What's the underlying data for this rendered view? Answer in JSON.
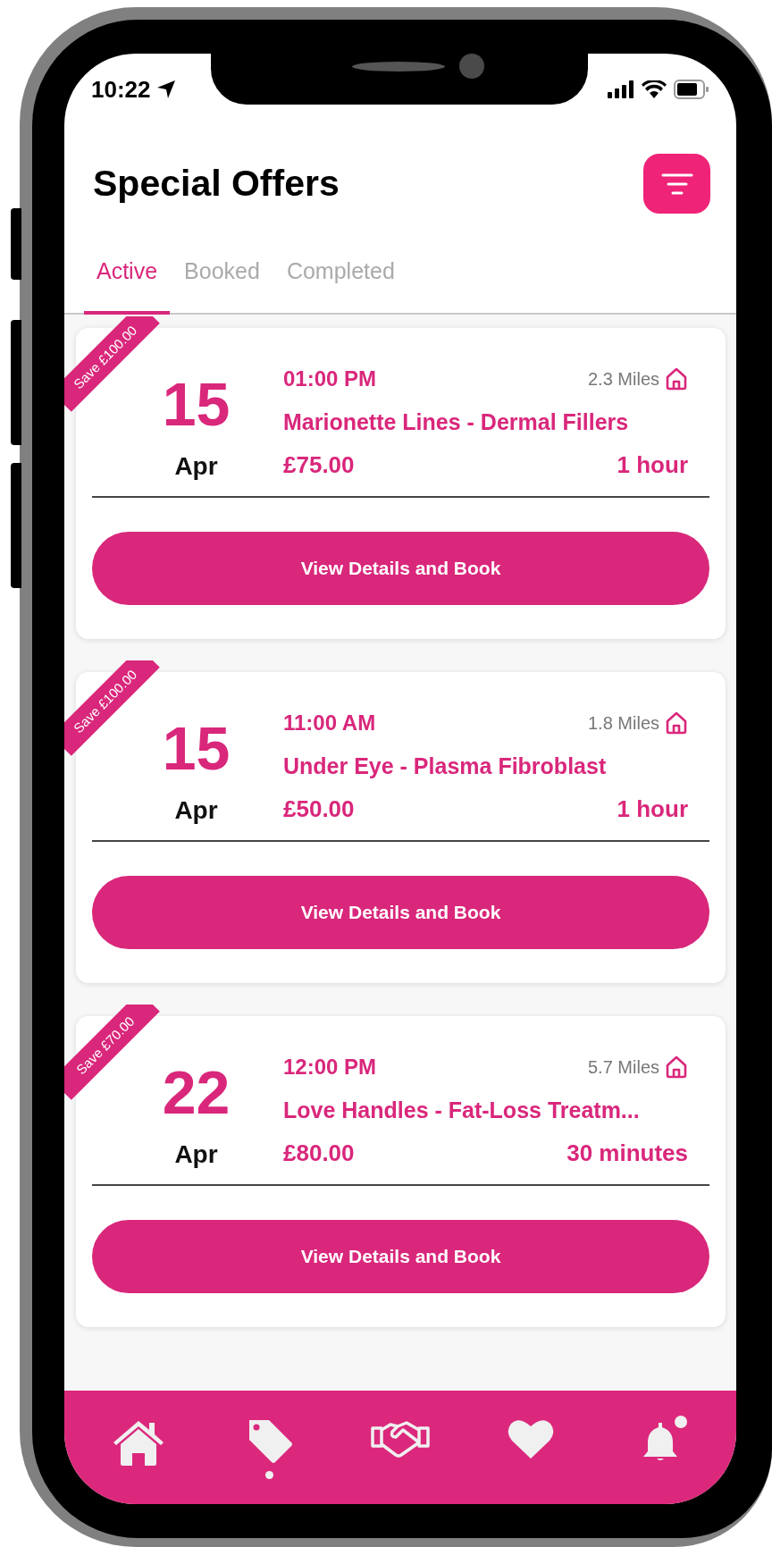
{
  "status_bar": {
    "time": "10:22"
  },
  "header": {
    "title": "Special Offers"
  },
  "tabs": [
    {
      "label": "Active",
      "selected": true
    },
    {
      "label": "Booked",
      "selected": false
    },
    {
      "label": "Completed",
      "selected": false
    }
  ],
  "offers": [
    {
      "ribbon": "Save £100.00",
      "day": "15",
      "month": "Apr",
      "time": "01:00 PM",
      "distance": "2.3 Miles",
      "title": "Marionette Lines - Dermal Fillers",
      "price": "£75.00",
      "duration": "1 hour",
      "button": "View Details and Book"
    },
    {
      "ribbon": "Save £100.00",
      "day": "15",
      "month": "Apr",
      "time": "11:00 AM",
      "distance": "1.8 Miles",
      "title": "Under Eye - Plasma Fibroblast",
      "price": "£50.00",
      "duration": "1 hour",
      "button": "View Details and Book"
    },
    {
      "ribbon": "Save £70.00",
      "day": "22",
      "month": "Apr",
      "time": "12:00 PM",
      "distance": "5.7 Miles",
      "title": "Love Handles - Fat-Loss Treatm...",
      "price": "£80.00",
      "duration": "30 minutes",
      "button": "View Details and Book"
    }
  ],
  "nav": [
    {
      "kind": "home",
      "selected": false,
      "badge": false
    },
    {
      "kind": "tag",
      "selected": true,
      "badge": false
    },
    {
      "kind": "handshake",
      "selected": false,
      "badge": false
    },
    {
      "kind": "heart",
      "selected": false,
      "badge": false
    },
    {
      "kind": "bell",
      "selected": false,
      "badge": true
    }
  ]
}
